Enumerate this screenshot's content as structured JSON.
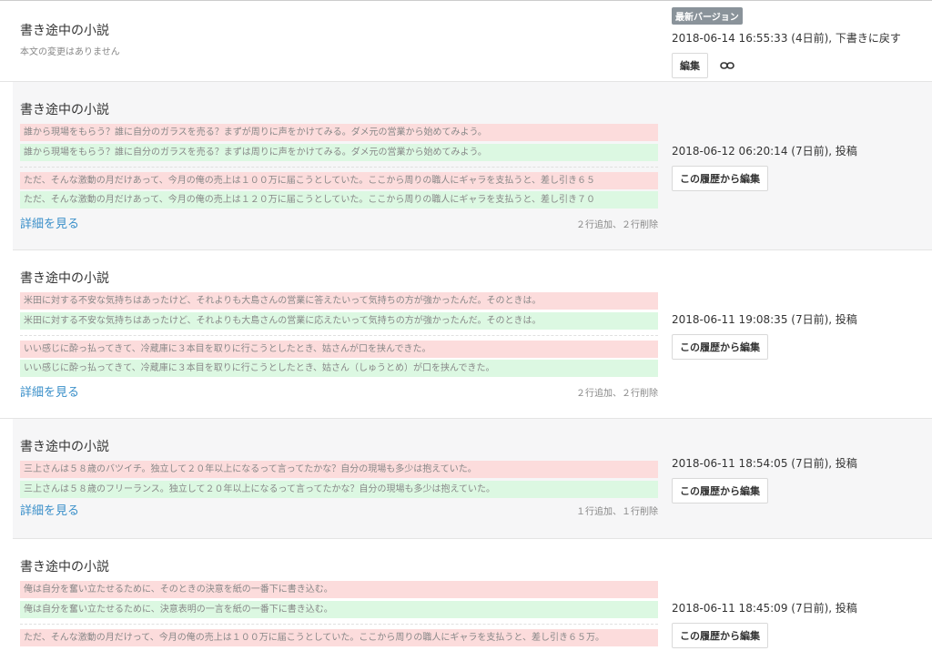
{
  "entries": [
    {
      "title": "書き途中の小説",
      "subtitle": "本文の変更はありません",
      "badge": "最新バージョン",
      "meta": "2018-06-14 16:55:33 (4日前), 下書きに戻す",
      "button": "編集",
      "link_icon": "link-icon"
    },
    {
      "title": "書き途中の小説",
      "diff_groups": [
        [
          {
            "type": "del",
            "text": "誰から現場をもらう？誰に自分のガラスを売る？まずが周りに声をかけてみる。ダメ元の営業から始めてみよう。"
          },
          {
            "type": "add",
            "text": "誰から現場をもらう？誰に自分のガラスを売る？まずは周りに声をかけてみる。ダメ元の営業から始めてみよう。"
          }
        ],
        [
          {
            "type": "del",
            "text": "ただ、そんな激動の月だけあって、今月の俺の売上は１００万に届こうとしていた。ここから周りの職人にギャラを支払うと、差し引き６５"
          },
          {
            "type": "add",
            "text": "ただ、そんな激動の月だけあって、今月の俺の売上は１２０万に届こうとしていた。ここから周りの職人にギャラを支払うと、差し引き７０"
          }
        ]
      ],
      "more": "詳細を見る",
      "stats": "２行追加、２行削除",
      "meta": "2018-06-12 06:20:14 (7日前), 投稿",
      "button": "この履歴から編集"
    },
    {
      "title": "書き途中の小説",
      "diff_groups": [
        [
          {
            "type": "del",
            "text": "米田に対する不安な気持ちはあったけど、それよりも大島さんの営業に答えたいって気持ちの方が強かったんだ。そのときは。"
          },
          {
            "type": "add",
            "text": "米田に対する不安な気持ちはあったけど、それよりも大島さんの営業に応えたいって気持ちの方が強かったんだ。そのときは。"
          }
        ],
        [
          {
            "type": "del",
            "text": "いい感じに酔っ払ってきて、冷蔵庫に３本目を取りに行こうとしたとき、姑さんが口を挟んできた。"
          },
          {
            "type": "add",
            "text": "いい感じに酔っ払ってきて、冷蔵庫に３本目を取りに行こうとしたとき、姑さん（しゅうとめ）が口を挟んできた。"
          }
        ]
      ],
      "more": "詳細を見る",
      "stats": "２行追加、２行削除",
      "meta": "2018-06-11 19:08:35 (7日前), 投稿",
      "button": "この履歴から編集"
    },
    {
      "title": "書き途中の小説",
      "diff_groups": [
        [
          {
            "type": "del",
            "text": "三上さんは５８歳のバツイチ。独立して２０年以上になるって言ってたかな？自分の現場も多少は抱えていた。"
          },
          {
            "type": "add",
            "text": "三上さんは５８歳のフリーランス。独立して２０年以上になるって言ってたかな？自分の現場も多少は抱えていた。"
          }
        ]
      ],
      "more": "詳細を見る",
      "stats": "１行追加、１行削除",
      "meta": "2018-06-11 18:54:05 (7日前), 投稿",
      "button": "この履歴から編集"
    },
    {
      "title": "書き途中の小説",
      "diff_groups": [
        [
          {
            "type": "del",
            "text": "俺は自分を奮い立たせるために、そのときの決意を紙の一番下に書き込む。"
          },
          {
            "type": "add",
            "text": "俺は自分を奮い立たせるために、決意表明の一言を紙の一番下に書き込む。"
          }
        ],
        [
          {
            "type": "del",
            "text": "ただ、そんな激動の月だけって、今月の俺の売上は１００万に届こうとしていた。ここから周りの職人にギャラを支払うと、差し引き６５万。"
          }
        ]
      ],
      "meta": "2018-06-11 18:45:09 (7日前), 投稿",
      "button": "この履歴から編集"
    }
  ]
}
